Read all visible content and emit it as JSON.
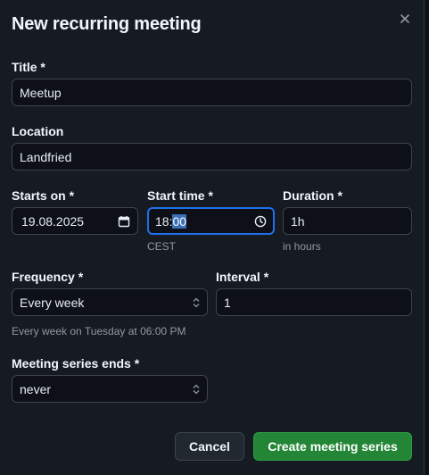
{
  "dialog": {
    "title": "New recurring meeting",
    "close_icon": "close-icon"
  },
  "form": {
    "title": {
      "label": "Title *",
      "value": "Meetup"
    },
    "location": {
      "label": "Location",
      "value": "Landfried"
    },
    "starts_on": {
      "label": "Starts on *",
      "value": "19.08.2025",
      "icon": "calendar-icon"
    },
    "start_time": {
      "label": "Start time *",
      "value_hours": "18:",
      "value_minutes": "00",
      "icon": "clock-icon",
      "help": "CEST"
    },
    "duration": {
      "label": "Duration *",
      "value": "1h",
      "help": "in hours"
    },
    "frequency": {
      "label": "Frequency *",
      "value": "Every week",
      "help": "Every week on Tuesday at 06:00 PM"
    },
    "interval": {
      "label": "Interval *",
      "value": "1"
    },
    "series_ends": {
      "label": "Meeting series ends *",
      "value": "never"
    }
  },
  "actions": {
    "cancel_label": "Cancel",
    "create_label": "Create meeting series"
  },
  "colors": {
    "background": "#161b22",
    "field_background": "#0d1117",
    "focus_border": "#1f6feb",
    "primary_button": "#238636",
    "selection_highlight": "#3b6fb6"
  }
}
